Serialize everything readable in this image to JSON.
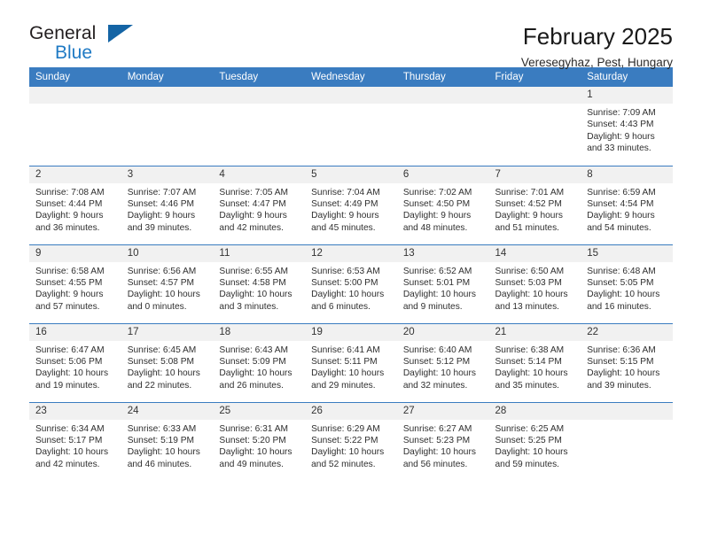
{
  "brand": {
    "name_top": "General",
    "name_bottom": "Blue",
    "accent_color": "#1f7ac4",
    "triangle_color": "#1464a5"
  },
  "header": {
    "title": "February 2025",
    "subtitle": "Veresegyhaz, Pest, Hungary"
  },
  "theme": {
    "header_row_bg": "#3a7cc0",
    "header_row_text": "#ffffff",
    "daynum_bg": "#f1f1f1",
    "row_divider": "#3a7cc0"
  },
  "weekday_headers": [
    "Sunday",
    "Monday",
    "Tuesday",
    "Wednesday",
    "Thursday",
    "Friday",
    "Saturday"
  ],
  "labels": {
    "sunrise_prefix": "Sunrise: ",
    "sunset_prefix": "Sunset: ",
    "daylight_prefix": "Daylight: "
  },
  "weeks": [
    [
      {
        "empty": true
      },
      {
        "empty": true
      },
      {
        "empty": true
      },
      {
        "empty": true
      },
      {
        "empty": true
      },
      {
        "empty": true
      },
      {
        "day": "1",
        "sunrise": "Sunrise: 7:09 AM",
        "sunset": "Sunset: 4:43 PM",
        "daylight": "Daylight: 9 hours and 33 minutes."
      }
    ],
    [
      {
        "day": "2",
        "sunrise": "Sunrise: 7:08 AM",
        "sunset": "Sunset: 4:44 PM",
        "daylight": "Daylight: 9 hours and 36 minutes."
      },
      {
        "day": "3",
        "sunrise": "Sunrise: 7:07 AM",
        "sunset": "Sunset: 4:46 PM",
        "daylight": "Daylight: 9 hours and 39 minutes."
      },
      {
        "day": "4",
        "sunrise": "Sunrise: 7:05 AM",
        "sunset": "Sunset: 4:47 PM",
        "daylight": "Daylight: 9 hours and 42 minutes."
      },
      {
        "day": "5",
        "sunrise": "Sunrise: 7:04 AM",
        "sunset": "Sunset: 4:49 PM",
        "daylight": "Daylight: 9 hours and 45 minutes."
      },
      {
        "day": "6",
        "sunrise": "Sunrise: 7:02 AM",
        "sunset": "Sunset: 4:50 PM",
        "daylight": "Daylight: 9 hours and 48 minutes."
      },
      {
        "day": "7",
        "sunrise": "Sunrise: 7:01 AM",
        "sunset": "Sunset: 4:52 PM",
        "daylight": "Daylight: 9 hours and 51 minutes."
      },
      {
        "day": "8",
        "sunrise": "Sunrise: 6:59 AM",
        "sunset": "Sunset: 4:54 PM",
        "daylight": "Daylight: 9 hours and 54 minutes."
      }
    ],
    [
      {
        "day": "9",
        "sunrise": "Sunrise: 6:58 AM",
        "sunset": "Sunset: 4:55 PM",
        "daylight": "Daylight: 9 hours and 57 minutes."
      },
      {
        "day": "10",
        "sunrise": "Sunrise: 6:56 AM",
        "sunset": "Sunset: 4:57 PM",
        "daylight": "Daylight: 10 hours and 0 minutes."
      },
      {
        "day": "11",
        "sunrise": "Sunrise: 6:55 AM",
        "sunset": "Sunset: 4:58 PM",
        "daylight": "Daylight: 10 hours and 3 minutes."
      },
      {
        "day": "12",
        "sunrise": "Sunrise: 6:53 AM",
        "sunset": "Sunset: 5:00 PM",
        "daylight": "Daylight: 10 hours and 6 minutes."
      },
      {
        "day": "13",
        "sunrise": "Sunrise: 6:52 AM",
        "sunset": "Sunset: 5:01 PM",
        "daylight": "Daylight: 10 hours and 9 minutes."
      },
      {
        "day": "14",
        "sunrise": "Sunrise: 6:50 AM",
        "sunset": "Sunset: 5:03 PM",
        "daylight": "Daylight: 10 hours and 13 minutes."
      },
      {
        "day": "15",
        "sunrise": "Sunrise: 6:48 AM",
        "sunset": "Sunset: 5:05 PM",
        "daylight": "Daylight: 10 hours and 16 minutes."
      }
    ],
    [
      {
        "day": "16",
        "sunrise": "Sunrise: 6:47 AM",
        "sunset": "Sunset: 5:06 PM",
        "daylight": "Daylight: 10 hours and 19 minutes."
      },
      {
        "day": "17",
        "sunrise": "Sunrise: 6:45 AM",
        "sunset": "Sunset: 5:08 PM",
        "daylight": "Daylight: 10 hours and 22 minutes."
      },
      {
        "day": "18",
        "sunrise": "Sunrise: 6:43 AM",
        "sunset": "Sunset: 5:09 PM",
        "daylight": "Daylight: 10 hours and 26 minutes."
      },
      {
        "day": "19",
        "sunrise": "Sunrise: 6:41 AM",
        "sunset": "Sunset: 5:11 PM",
        "daylight": "Daylight: 10 hours and 29 minutes."
      },
      {
        "day": "20",
        "sunrise": "Sunrise: 6:40 AM",
        "sunset": "Sunset: 5:12 PM",
        "daylight": "Daylight: 10 hours and 32 minutes."
      },
      {
        "day": "21",
        "sunrise": "Sunrise: 6:38 AM",
        "sunset": "Sunset: 5:14 PM",
        "daylight": "Daylight: 10 hours and 35 minutes."
      },
      {
        "day": "22",
        "sunrise": "Sunrise: 6:36 AM",
        "sunset": "Sunset: 5:15 PM",
        "daylight": "Daylight: 10 hours and 39 minutes."
      }
    ],
    [
      {
        "day": "23",
        "sunrise": "Sunrise: 6:34 AM",
        "sunset": "Sunset: 5:17 PM",
        "daylight": "Daylight: 10 hours and 42 minutes."
      },
      {
        "day": "24",
        "sunrise": "Sunrise: 6:33 AM",
        "sunset": "Sunset: 5:19 PM",
        "daylight": "Daylight: 10 hours and 46 minutes."
      },
      {
        "day": "25",
        "sunrise": "Sunrise: 6:31 AM",
        "sunset": "Sunset: 5:20 PM",
        "daylight": "Daylight: 10 hours and 49 minutes."
      },
      {
        "day": "26",
        "sunrise": "Sunrise: 6:29 AM",
        "sunset": "Sunset: 5:22 PM",
        "daylight": "Daylight: 10 hours and 52 minutes."
      },
      {
        "day": "27",
        "sunrise": "Sunrise: 6:27 AM",
        "sunset": "Sunset: 5:23 PM",
        "daylight": "Daylight: 10 hours and 56 minutes."
      },
      {
        "day": "28",
        "sunrise": "Sunrise: 6:25 AM",
        "sunset": "Sunset: 5:25 PM",
        "daylight": "Daylight: 10 hours and 59 minutes."
      },
      {
        "empty": true
      }
    ]
  ]
}
